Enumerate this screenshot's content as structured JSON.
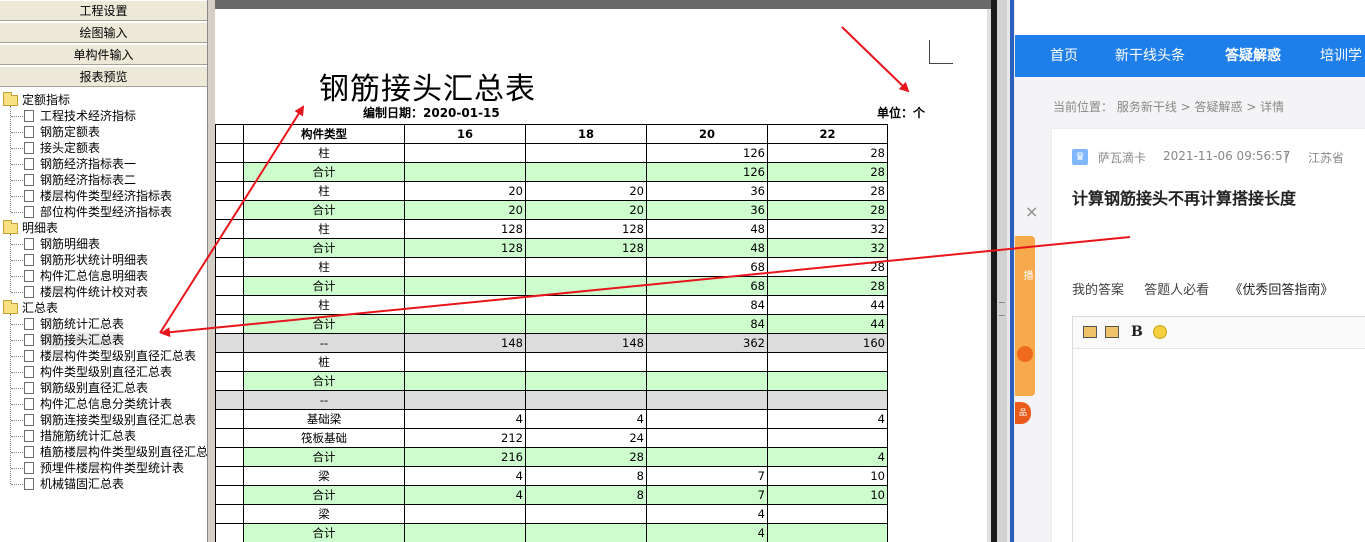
{
  "left_nav": {
    "buttons": [
      "工程设置",
      "绘图输入",
      "单构件输入",
      "报表预览"
    ],
    "groups": [
      {
        "label": "定额指标",
        "items": [
          "工程技术经济指标",
          "钢筋定额表",
          "接头定额表",
          "钢筋经济指标表一",
          "钢筋经济指标表二",
          "楼层构件类型经济指标表",
          "部位构件类型经济指标表"
        ]
      },
      {
        "label": "明细表",
        "items": [
          "钢筋明细表",
          "钢筋形状统计明细表",
          "构件汇总信息明细表",
          "楼层构件统计校对表"
        ]
      },
      {
        "label": "汇总表",
        "items": [
          "钢筋统计汇总表",
          "钢筋接头汇总表",
          "楼层构件类型级别直径汇总表",
          "构件类型级别直径汇总表",
          "钢筋级别直径汇总表",
          "构件汇总信息分类统计表",
          "钢筋连接类型级别直径汇总表",
          "措施筋统计汇总表",
          "植筋楼层构件类型级别直径汇总",
          "预埋件楼层构件类型统计表",
          "机械锚固汇总表"
        ]
      }
    ],
    "selected_item": "钢筋接头汇总表"
  },
  "report": {
    "title": "钢筋接头汇总表",
    "date_text": "编制日期：2020-01-15",
    "unit_text": "单位：个",
    "headers": [
      "构件类型",
      "16",
      "18",
      "20",
      "22"
    ],
    "rows": [
      {
        "type": "柱",
        "kind": "item",
        "values": [
          "",
          "",
          "126",
          "28"
        ]
      },
      {
        "type": "合计",
        "kind": "sub",
        "values": [
          "",
          "",
          "126",
          "28"
        ]
      },
      {
        "type": "柱",
        "kind": "item",
        "values": [
          "20",
          "20",
          "36",
          "28"
        ]
      },
      {
        "type": "合计",
        "kind": "sub",
        "values": [
          "20",
          "20",
          "36",
          "28"
        ]
      },
      {
        "type": "柱",
        "kind": "item",
        "values": [
          "128",
          "128",
          "48",
          "32"
        ]
      },
      {
        "type": "合计",
        "kind": "sub",
        "values": [
          "128",
          "128",
          "48",
          "32"
        ]
      },
      {
        "type": "柱",
        "kind": "item",
        "values": [
          "",
          "",
          "68",
          "28"
        ]
      },
      {
        "type": "合计",
        "kind": "sub",
        "values": [
          "",
          "",
          "68",
          "28"
        ]
      },
      {
        "type": "柱",
        "kind": "item",
        "values": [
          "",
          "",
          "84",
          "44"
        ]
      },
      {
        "type": "合计",
        "kind": "sub",
        "values": [
          "",
          "",
          "84",
          "44"
        ]
      },
      {
        "type": "--",
        "kind": "dash",
        "values": [
          "148",
          "148",
          "362",
          "160"
        ]
      },
      {
        "type": "桩",
        "kind": "item",
        "values": [
          "",
          "",
          "",
          ""
        ]
      },
      {
        "type": "合计",
        "kind": "sub",
        "values": [
          "",
          "",
          "",
          ""
        ]
      },
      {
        "type": "--",
        "kind": "dash",
        "values": [
          "",
          "",
          "",
          ""
        ]
      },
      {
        "type": "基础梁",
        "kind": "item",
        "values": [
          "4",
          "4",
          "",
          "4"
        ]
      },
      {
        "type": "筏板基础",
        "kind": "item",
        "values": [
          "212",
          "24",
          "",
          ""
        ]
      },
      {
        "type": "合计",
        "kind": "sub",
        "values": [
          "216",
          "28",
          "",
          "4"
        ]
      },
      {
        "type": "梁",
        "kind": "item",
        "values": [
          "4",
          "8",
          "7",
          "10"
        ]
      },
      {
        "type": "合计",
        "kind": "sub",
        "values": [
          "4",
          "8",
          "7",
          "10"
        ]
      },
      {
        "type": "梁",
        "kind": "item",
        "values": [
          "",
          "",
          "4",
          ""
        ]
      },
      {
        "type": "合计",
        "kind": "sub",
        "values": [
          "",
          "",
          "4",
          ""
        ]
      }
    ]
  },
  "web": {
    "nav": [
      "首页",
      "新干线头条",
      "答疑解惑",
      "培训学"
    ],
    "active_nav": "答疑解惑",
    "breadcrumb": "当前位置：  服务新干线 > 答疑解惑 > 详情",
    "author": "萨瓦滴卡",
    "time": "2021-11-06 09:56:57",
    "separator": "|",
    "region": "江苏省 ",
    "question_title": "计算钢筋接头不再计算搭接长度",
    "answer_tabs": [
      "我的答案",
      "答题人必看",
      "《优秀回答指南》"
    ],
    "close_symbol": "×",
    "editor_bold": "B",
    "side_badge_text": "品",
    "side_strip_text": "播"
  },
  "colors": {
    "subtotal_row": "#cdfccd",
    "dash_row": "#dcdcdc",
    "web_nav": "#1f7fea",
    "annotation": "#e8141c"
  },
  "icons": [
    "folder-icon",
    "document-icon",
    "close-icon",
    "image-icon",
    "emoji-icon"
  ]
}
